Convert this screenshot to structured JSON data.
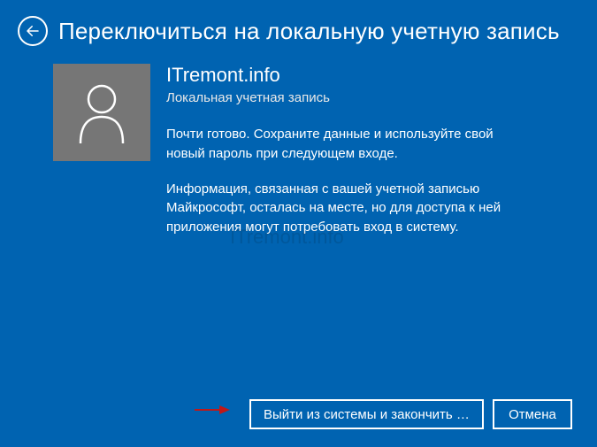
{
  "header": {
    "title": "Переключиться на локальную учетную запись"
  },
  "user": {
    "name": "ITremont.info",
    "account_type": "Локальная учетная запись"
  },
  "body": {
    "para1": "Почти готово. Сохраните данные и используйте свой новый пароль при следующем входе.",
    "para2": "Информация, связанная с вашей учетной записью Майкрософт, осталась на месте, но для доступа к ней приложения могут потребовать вход в систему."
  },
  "buttons": {
    "primary": "Выйти из системы и закончить р...",
    "cancel": "Отмена"
  },
  "watermark": "ITremont.info"
}
